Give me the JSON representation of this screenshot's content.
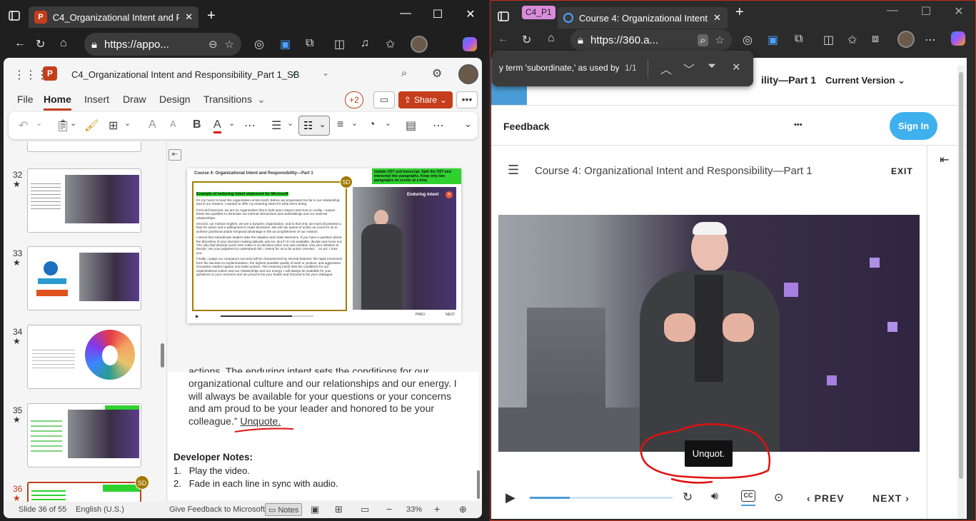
{
  "left_window": {
    "tab_title": "C4_Organizational Intent and Res",
    "address": "https://appo...",
    "ppt_title": "C4_Organizational Intent and Responsibility_Part 1_SB",
    "menu": [
      "File",
      "Home",
      "Insert",
      "Draw",
      "Design",
      "Transitions"
    ],
    "active_menu": "Home",
    "collab_count": "+2",
    "share_label": "Share",
    "slides": [
      {
        "num": "32",
        "star": "★"
      },
      {
        "num": "33",
        "star": "★"
      },
      {
        "num": "34",
        "star": "★"
      },
      {
        "num": "35",
        "star": "★"
      },
      {
        "num": "36",
        "star": "★"
      }
    ],
    "slide": {
      "title": "Course 4: Organizational Intent and Responsibility—Part 1",
      "example_heading": "Example of enduring intent statement for Microsoft",
      "green_note": "Update OST and transcript. Split the OST and transcript into paragraphs. Keep only two paragraphs on screen at a time.",
      "video_label": "Enduring intent",
      "author_badge": "SD",
      "prev": "PREV",
      "next": "NEXT",
      "paragraphs": [
        "It's my honor to lead this organization at Microsoft. Before we progressed too far in our relationship, and in our mission, I wanted to offer my enduring intent for what we're doing.",
        "First and foremost, we are an organization that is built upon respect and trust on civility. I expect these two qualities to dominate our internal interactions and undertakings and our external relationships.",
        "Second, our mission implies, we are a dynamic organization, and to that end, we must all possess a bias for action and a willingness to make decisions. We will use speed of action as a tool for us to achieve positional and/or temporal advantage in the accomplishment of our mission.",
        "I intend that subordinate leaders take the initiative and make decisions. If you have a question about the discretion of your decision-making latitude, ask me. But if I'm not available, decide and move out. The only bad decision you'll ever make is no decision when one was needed. Use your initiative to decide, use your judgment to understand risk, I intend for us to be action oriented ... so act. I trust you.",
        "Finally, I judge our company's success will be characterized by several features: the rapid movement from the decision to implementation, the highest possible quality of work or product, and aggressive, innovative market capture and sales actions. The enduring intent sets the conditions for our organizational culture and our relationships and our energy. I will always be available for your questions or your concerns and am proud to be your leader and honored to be your colleague."
      ]
    },
    "notes": {
      "cutoff_line": "actions. The enduring intent sets the conditions for our",
      "text": "organizational culture and our relationships and our energy. I will always be available for your questions or your concerns and am proud to be your leader and honored to be your colleague.”",
      "unquote": "Unquote.",
      "dev_heading": "Developer Notes:",
      "dev_items": [
        "Play the video.",
        "Fade in each line in sync with audio."
      ]
    },
    "status": {
      "slide": "Slide 36 of 55",
      "language": "English (U.S.)",
      "feedback": "Give Feedback to Microsoft",
      "notes": "Notes",
      "zoom": "33%"
    }
  },
  "right_window": {
    "tab_group": "C4_P1",
    "tab_title": "Course 4: Organizational Intent an",
    "address": "https://360.a...",
    "find": {
      "query": "y term 'subordinate,' as used by",
      "count": "1/1"
    },
    "header_title": "ility—Part 1",
    "version": "Current Version",
    "feedback": "Feedback",
    "more": "•••",
    "sign_in": "Sign In",
    "course_title": "Course 4: Organizational Intent and Responsibility—Part 1",
    "exit": "EXIT",
    "caption": "Unquot.",
    "prev": "PREV",
    "next": "NEXT",
    "progress": 0.28,
    "accent": "#4a9cd6"
  }
}
